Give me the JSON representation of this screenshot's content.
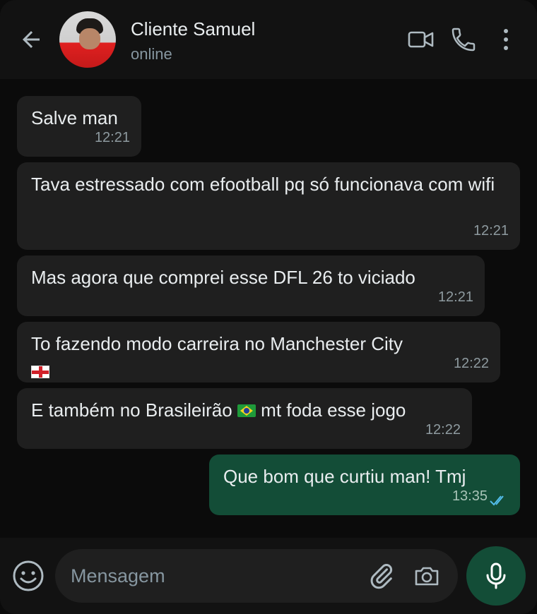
{
  "header": {
    "contact_name": "Cliente Samuel",
    "status": "online",
    "icons": [
      "back-arrow-icon",
      "video-call-icon",
      "phone-icon",
      "more-vertical-icon"
    ]
  },
  "messages": [
    {
      "direction": "incoming",
      "text": "Salve man",
      "time": "12:21"
    },
    {
      "direction": "incoming",
      "text": "Tava estressado com efootball pq só funcionava com wifi",
      "time": "12:21"
    },
    {
      "direction": "incoming",
      "text": "Mas agora que comprei esse DFL 26 to viciado",
      "time": "12:21"
    },
    {
      "direction": "incoming",
      "text": "To fazendo modo carreira no Manchester City",
      "emoji": "england-flag",
      "time": "12:22"
    },
    {
      "direction": "incoming",
      "text_before": "E também no Brasileirão",
      "emoji": "brazil-flag",
      "text_after": " mt foda esse jogo",
      "time": "12:22"
    },
    {
      "direction": "outgoing",
      "text": "Que bom que curtiu man! Tmj",
      "time": "13:35",
      "read": true
    }
  ],
  "composer": {
    "placeholder": "Mensagem",
    "icons": [
      "emoji-icon",
      "attach-icon",
      "camera-icon",
      "mic-icon"
    ]
  },
  "colors": {
    "background": "#0b0b0b",
    "header": "#121212",
    "incoming_bubble": "#1f1f1f",
    "outgoing_bubble": "#134d37",
    "read_ticks": "#53bdeb",
    "secondary_text": "#8696a0"
  }
}
